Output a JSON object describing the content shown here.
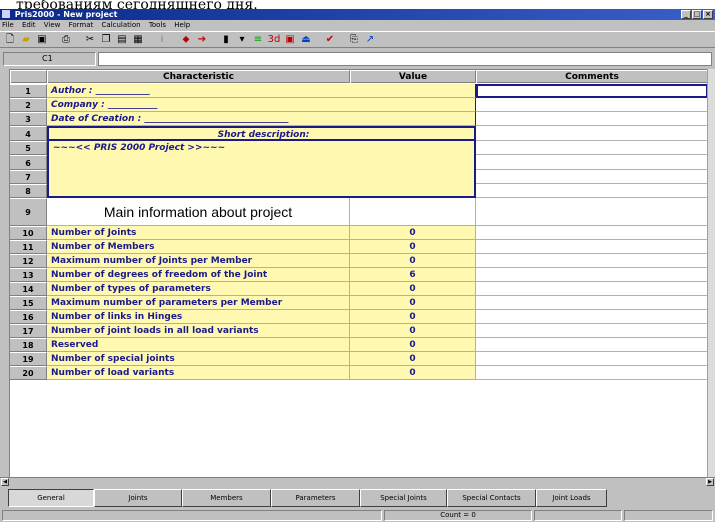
{
  "overlay_text": "требованиям сегодняшнего дня.",
  "window": {
    "title": "Pris2000 - New project",
    "controls": [
      "_",
      "□",
      "×"
    ]
  },
  "menu": [
    "File",
    "Edit",
    "View",
    "Format",
    "Calculation",
    "Tools",
    "Help"
  ],
  "formula_bar": {
    "cell_ref": "C1",
    "value": ""
  },
  "columns": [
    "Characteristic",
    "Value",
    "Comments"
  ],
  "rows": [
    {
      "num": "1",
      "characteristic": "Author : ____________",
      "value": "",
      "comment": ""
    },
    {
      "num": "2",
      "characteristic": "Company : ___________",
      "value": "",
      "comment": ""
    },
    {
      "num": "3",
      "characteristic": "Date of Creation : ________________________________",
      "value": "",
      "comment": ""
    },
    {
      "num": "4",
      "characteristic": "Short description:",
      "value": "",
      "comment": ""
    },
    {
      "num": "5",
      "characteristic": "~~~<< PRIS 2000 Project >>~~~",
      "value": "",
      "comment": ""
    },
    {
      "num": "6",
      "characteristic": "",
      "value": "",
      "comment": ""
    },
    {
      "num": "7",
      "characteristic": "",
      "value": "",
      "comment": ""
    },
    {
      "num": "8",
      "characteristic": "",
      "value": "",
      "comment": ""
    },
    {
      "num": "9",
      "characteristic": "Main information about project",
      "value": "",
      "comment": ""
    },
    {
      "num": "10",
      "characteristic": "Number of Joints",
      "value": "0",
      "comment": ""
    },
    {
      "num": "11",
      "characteristic": "Number of Members",
      "value": "0",
      "comment": ""
    },
    {
      "num": "12",
      "characteristic": "Maximum number of Joints per Member",
      "value": "0",
      "comment": ""
    },
    {
      "num": "13",
      "characteristic": "Number of degrees of freedom of the Joint",
      "value": "6",
      "comment": ""
    },
    {
      "num": "14",
      "characteristic": "Number of types of parameters",
      "value": "0",
      "comment": ""
    },
    {
      "num": "15",
      "characteristic": "Maximum number of parameters per Member",
      "value": "0",
      "comment": ""
    },
    {
      "num": "16",
      "characteristic": "Number of links in Hinges",
      "value": "0",
      "comment": ""
    },
    {
      "num": "17",
      "characteristic": "Number of joint loads in all load variants",
      "value": "0",
      "comment": ""
    },
    {
      "num": "18",
      "characteristic": "Reserved",
      "value": "0",
      "comment": ""
    },
    {
      "num": "19",
      "characteristic": "Number of special joints",
      "value": "0",
      "comment": ""
    },
    {
      "num": "20",
      "characteristic": "Number of load variants",
      "value": "0",
      "comment": ""
    }
  ],
  "tabs": [
    "General",
    "Joints",
    "Members",
    "Parameters",
    "Special Joints",
    "Special Contacts",
    "Joint Loads"
  ],
  "status": {
    "count": "Count = 0"
  },
  "colors": {
    "title_bar": "#0a2a8a",
    "cell_fill": "#fff8b0",
    "field_text": "#1a1a8a",
    "chrome": "#c0c0c0"
  },
  "toolbar_icons": [
    "new-file-icon",
    "open-folder-icon",
    "save-icon",
    "print-icon",
    "cut-icon",
    "copy-icon",
    "paste-icon",
    "table-icon",
    "insert-row-icon",
    "delete-row-icon",
    "column-icon",
    "chart-icon",
    "spreadsheet-icon",
    "calculator-icon",
    "check-icon",
    "export-icon",
    "help-icon"
  ]
}
